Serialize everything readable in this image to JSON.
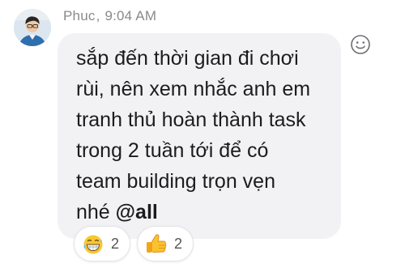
{
  "message": {
    "sender": "Phuc",
    "separator": ",",
    "time": "9:04 AM",
    "text_lines": [
      "sắp đến thời gian đi chơi",
      "rùi, nên xem nhắc anh em",
      "tranh thủ hoàn thành task",
      "trong 2 tuần tới để có",
      "team building trọn vẹn"
    ],
    "last_line_text": "nhé ",
    "mention": "@all"
  },
  "reactions": [
    {
      "icon": "grinning-sweat-face-icon",
      "count": "2"
    },
    {
      "icon": "thumbs-up-icon",
      "count": "2"
    }
  ],
  "colors": {
    "bubble": "#f2f2f4",
    "meta_text": "#8a8a8e",
    "message_text": "#1c1c1e"
  }
}
